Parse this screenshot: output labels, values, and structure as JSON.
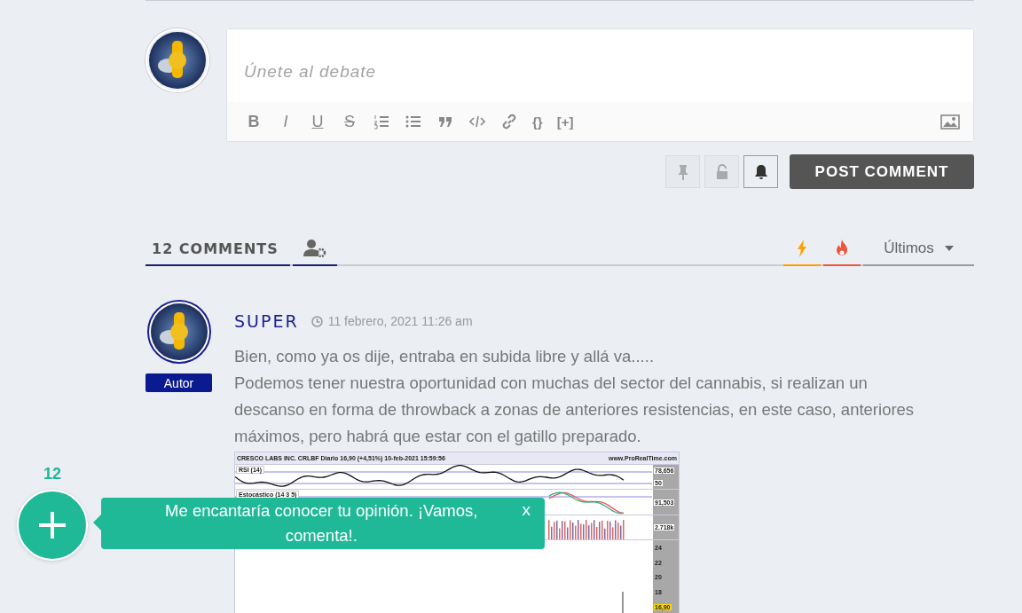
{
  "editor": {
    "placeholder": "Únete al debate",
    "toolbar": [
      {
        "kind": "bold",
        "label": "B"
      },
      {
        "kind": "italic",
        "label": "I"
      },
      {
        "kind": "underline",
        "label": "U"
      },
      {
        "kind": "strike",
        "label": "S"
      },
      {
        "kind": "ordered-list"
      },
      {
        "kind": "bullet-list"
      },
      {
        "kind": "quote"
      },
      {
        "kind": "code"
      },
      {
        "kind": "link"
      },
      {
        "kind": "text",
        "label": "{}"
      },
      {
        "kind": "text",
        "label": "[+]"
      },
      {
        "kind": "image"
      }
    ],
    "actions": [
      {
        "kind": "pin",
        "active": false
      },
      {
        "kind": "lock",
        "active": false
      },
      {
        "kind": "bell",
        "active": true
      }
    ],
    "submit": "POST COMMENT"
  },
  "comments_bar": {
    "tabs": [
      {
        "kind": "text",
        "label": "12 COMMENTS",
        "selected": true
      },
      {
        "kind": "users",
        "selected": true
      }
    ],
    "sort_tabs": [
      {
        "kind": "bolt",
        "color": "#ffa000"
      },
      {
        "kind": "fire",
        "color": "#f0533c"
      }
    ],
    "sort_dropdown": "Últimos"
  },
  "comment": {
    "author": "SUPER",
    "badge": "Autor",
    "date": "11 febrero, 2021 11:26 am",
    "paragraphs": [
      "Bien, como ya os dije, entraba en subida libre y allá va.....",
      "Podemos tener nuestra oportunidad con muchas del sector del cannabis, si realizan un descanso en forma de throwback a zonas de anteriores resistencias, en este caso, anteriores máximos, pero habrá que estar con el gatillo preparado."
    ],
    "chart_image": {
      "title": "CRESCO LABS INC. CRLBF Diario 16,90 (+4,51%) 10-feb-2021 15:59:56",
      "source": "www.ProRealTime.com",
      "panels": [
        {
          "kind": "rsi",
          "label": "RSI (14)",
          "axis": [
            "78,656",
            "50"
          ]
        },
        {
          "kind": "stochastic",
          "label": "Estocástico (14 3 5)",
          "axis": [
            "91,503"
          ]
        },
        {
          "kind": "volume",
          "axis": [
            "2.718k"
          ]
        },
        {
          "kind": "price",
          "axis": [
            "24",
            "22",
            "20",
            "18",
            "16,90"
          ]
        }
      ]
    }
  },
  "floating": {
    "count": "12",
    "message": "Me encantaría conocer tu opinión. ¡Vamos, comenta!.",
    "close": "x"
  }
}
